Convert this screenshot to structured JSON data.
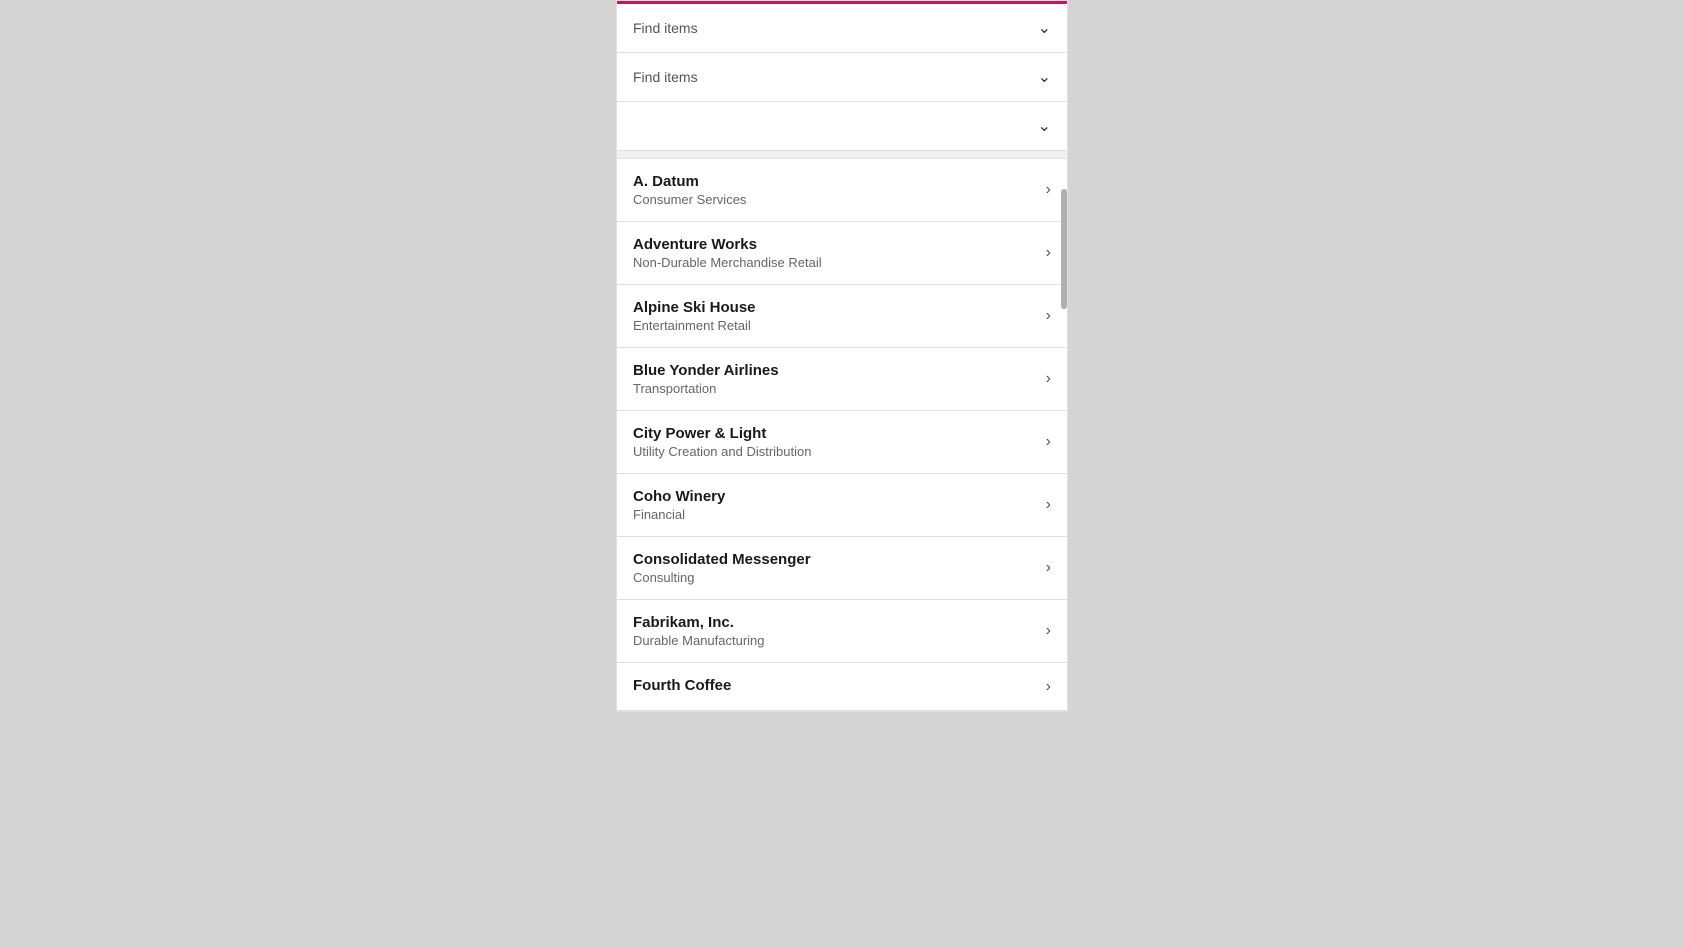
{
  "panel": {
    "accent_color": "#c0185a",
    "dropdowns": [
      {
        "placeholder": "Find items",
        "id": "dropdown-1"
      },
      {
        "placeholder": "Find items",
        "id": "dropdown-2"
      },
      {
        "placeholder": "",
        "id": "dropdown-3"
      }
    ],
    "items": [
      {
        "name": "A. Datum",
        "subtitle": "Consumer Services"
      },
      {
        "name": "Adventure Works",
        "subtitle": "Non-Durable Merchandise Retail"
      },
      {
        "name": "Alpine Ski House",
        "subtitle": "Entertainment Retail"
      },
      {
        "name": "Blue Yonder Airlines",
        "subtitle": "Transportation"
      },
      {
        "name": "City Power & Light",
        "subtitle": "Utility Creation and Distribution"
      },
      {
        "name": "Coho Winery",
        "subtitle": "Financial"
      },
      {
        "name": "Consolidated Messenger",
        "subtitle": "Consulting"
      },
      {
        "name": "Fabrikam, Inc.",
        "subtitle": "Durable Manufacturing"
      },
      {
        "name": "Fourth Coffee",
        "subtitle": ""
      }
    ],
    "chevron_symbol": "›",
    "chevron_down_symbol": "⌄"
  }
}
